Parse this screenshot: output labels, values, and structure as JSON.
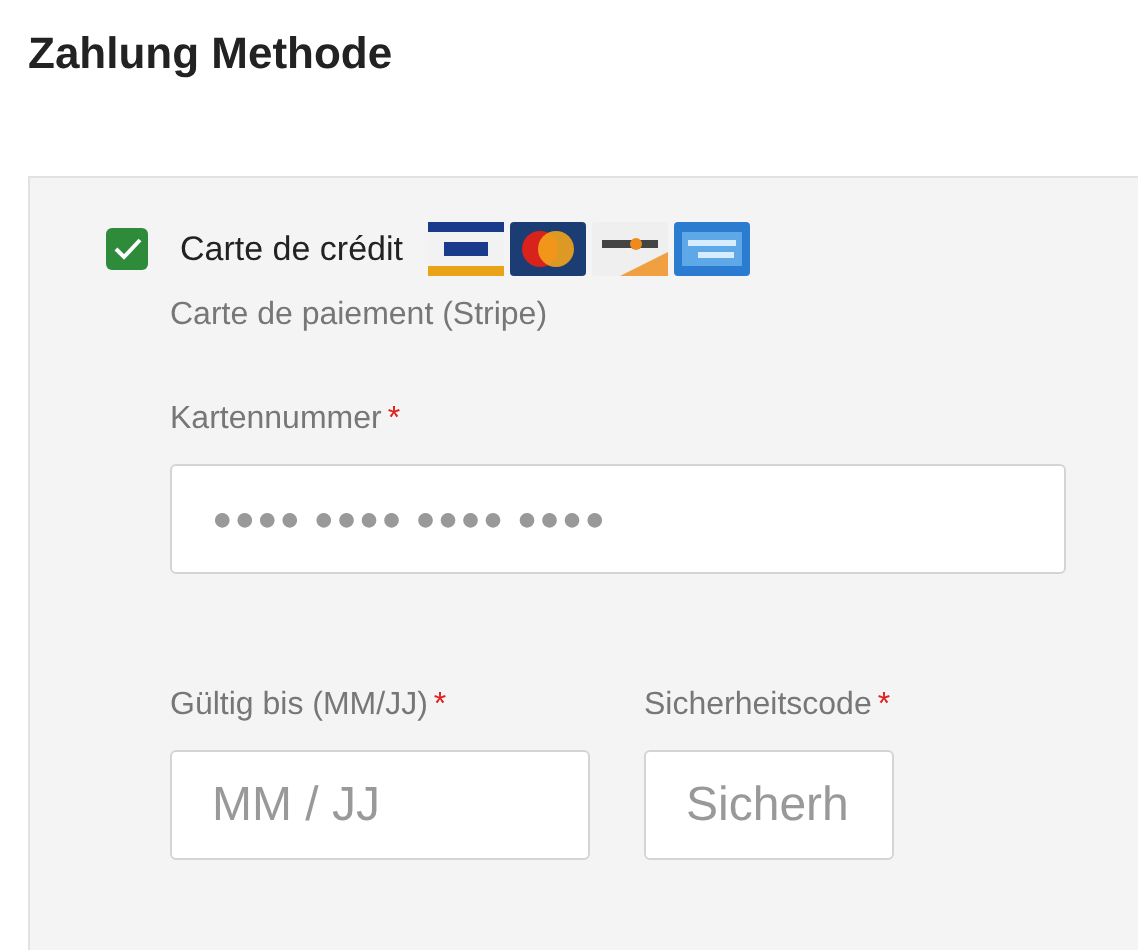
{
  "title": "Zahlung Methode",
  "payment_method": {
    "label": "Carte de crédit",
    "checked": true,
    "card_logos": [
      {
        "kind": "visa"
      },
      {
        "kind": "mastercard"
      },
      {
        "kind": "discover"
      },
      {
        "kind": "amex"
      }
    ],
    "description": "Carte de paiement (Stripe)"
  },
  "fields": [
    {
      "label": "Kartennummer",
      "required_mark": "*",
      "placeholder": "●●●● ●●●● ●●●● ●●●●",
      "kind": "card"
    },
    {
      "label": "Gültig bis (MM/JJ)",
      "required_mark": "*",
      "placeholder": "MM / JJ",
      "kind": "expiry"
    },
    {
      "label": "Sicherheitscode",
      "required_mark": "*",
      "placeholder": "Sicherh",
      "kind": "cvc"
    }
  ]
}
